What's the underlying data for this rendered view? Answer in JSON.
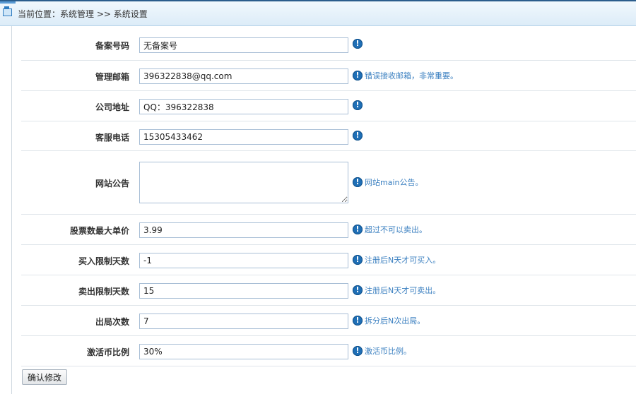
{
  "header": {
    "breadcrumb": "当前位置：系统管理 >> 系统设置"
  },
  "form": {
    "rows": [
      {
        "label": "备案号码",
        "value": "无备案号",
        "hint": ""
      },
      {
        "label": "管理邮箱",
        "value": "396322838@qq.com",
        "hint": "错误接收邮箱，非常重要。"
      },
      {
        "label": "公司地址",
        "value": "QQ：396322838",
        "hint": ""
      },
      {
        "label": "客服电话",
        "value": "15305433462",
        "hint": ""
      },
      {
        "label": "网站公告",
        "value": "",
        "hint": "网站main公告。"
      },
      {
        "label": "股票数最大单价",
        "value": "3.99",
        "hint": "超过不可以卖出。"
      },
      {
        "label": "买入限制天数",
        "value": "-1",
        "hint": "注册后N天才可买入。"
      },
      {
        "label": "卖出限制天数",
        "value": "15",
        "hint": "注册后N天才可卖出。"
      },
      {
        "label": "出局次数",
        "value": "7",
        "hint": "拆分后N次出局。"
      },
      {
        "label": "激活币比例",
        "value": "30%",
        "hint": "激活币比例。"
      }
    ],
    "info_icon_glyph": "!",
    "submit_label": "确认修改"
  },
  "colors": {
    "hint_text": "#3a7fc0",
    "info_icon": "#1f6fb6",
    "header_border": "#2b5d8c"
  },
  "icons": {
    "breadcrumb": "home-icon",
    "hint": "info-icon"
  }
}
